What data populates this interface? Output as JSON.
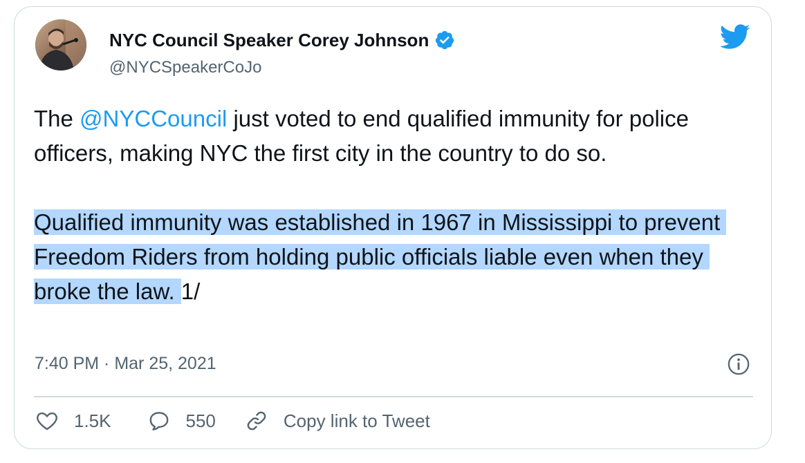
{
  "tweet": {
    "display_name": "NYC Council Speaker Corey Johnson",
    "handle": "@NYCSpeakerCoJo",
    "text_prefix": "The ",
    "mention": "@NYCCouncil",
    "text_rest": " just voted to end qualified immunity for police officers, making NYC the first city in the country to do so.\n\n",
    "highlighted_text": "Qualified immunity was established in 1967 in Mississippi to prevent Freedom Riders from holding public officials liable even when they broke the law. ",
    "text_suffix": "1/",
    "timestamp": "7:40 PM · Mar 25, 2021"
  },
  "actions": {
    "like_count": "1.5K",
    "reply_count": "550",
    "copy_link_label": "Copy link to Tweet"
  },
  "icons": {
    "avatar": "avatar-photo",
    "verified": "verified-badge-icon",
    "brand": "twitter-bird-icon",
    "info": "info-icon",
    "like": "heart-icon",
    "reply": "speech-bubble-icon",
    "copy": "link-icon"
  },
  "colors": {
    "accent": "#1d9bf0",
    "text": "#0f1419",
    "secondary_text": "#536471",
    "border": "#cfd9de",
    "selection_highlight": "#b3d7ff"
  }
}
